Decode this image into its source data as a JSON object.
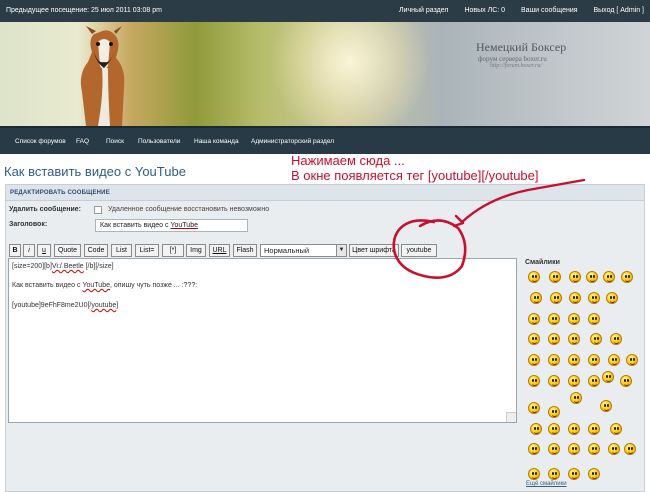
{
  "topbar": {
    "last_visit": "Предыдущее посещение: 25 июл 2011 03:08 pm",
    "links": [
      "Личный раздел",
      "Новых ЛС: 0",
      "Ваши сообщения",
      "Выход [ Admin ]"
    ]
  },
  "banner": {
    "title": "Немецкий Боксер",
    "subtitle": "форум сервера boxer.ru",
    "url": "http://forum.boxer.ru/"
  },
  "nav": {
    "items": [
      "Список форумов",
      "FAQ",
      "Поиск",
      "Пользователи",
      "Наша команда",
      "Администраторский раздел"
    ]
  },
  "page": {
    "title": "Как вставить видео с YouTube"
  },
  "annotation": {
    "line1": "Нажимаем сюда ...",
    "line2": "В окне появляется тег [youtube][/youtube]"
  },
  "form": {
    "header": "РЕДАКТИРОВАТЬ СООБЩЕНИЕ",
    "delete_label": "Удалить сообщение:",
    "delete_note": "Удаленное сообщение восстановить невозможно",
    "subject_label": "Заголовок:",
    "subject_prefix": "Как вставить видео с ",
    "subject_word": "YouTube"
  },
  "toolbar": {
    "buttons": [
      "B",
      "i",
      "u",
      "Quote",
      "Code",
      "List",
      "List=",
      "[*]",
      "Img",
      "URL",
      "Flash"
    ],
    "font_size_value": "Нормальный",
    "font_color": "Цвет шрифта",
    "youtube": "youtube"
  },
  "editor": {
    "line1_a": "[size=200][b]",
    "line1_b": "Vi:/ Beetle",
    "line1_c": " [/b][/size]",
    "line2_a": "Как вставить видео с ",
    "line2_b": "YouTube",
    "line2_c": ", опишу чуть позже ... :???:",
    "line3_a": "[youtube]9eFhF8me2U0[/",
    "line3_b": "youtube",
    "line3_c": "]"
  },
  "smilies": {
    "title": "Смайлики",
    "footer": "Ещё смайлики"
  },
  "colors": {
    "topbar_bg": "#2c3c47",
    "nav_bg": "#283a46",
    "title_blue": "#2f5e86",
    "annotation_red": "#c8102e",
    "panel_bg": "#e9edf0"
  }
}
